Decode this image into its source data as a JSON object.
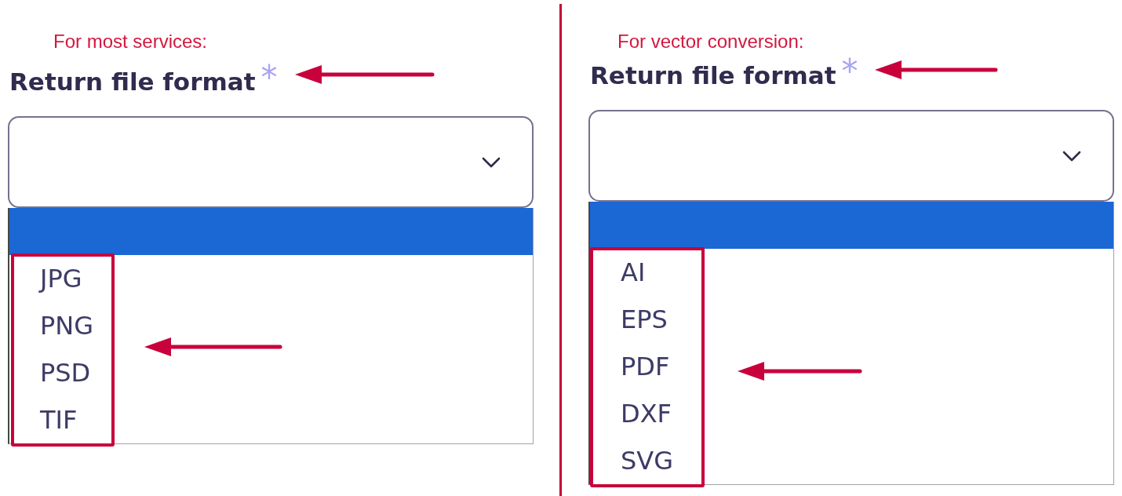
{
  "panels": [
    {
      "note": "For most services:",
      "field": {
        "label": "Return file format",
        "required_mark": "*",
        "expanded": true,
        "options": [
          {
            "selected": true
          },
          {
            "label": "JPG",
            "selected": false
          },
          {
            "label": "PNG",
            "selected": false
          },
          {
            "label": "PSD",
            "selected": false
          },
          {
            "label": "TIF",
            "selected": false
          }
        ]
      }
    },
    {
      "note": "For vector conversion:",
      "field": {
        "label": "Return file format",
        "required_mark": "*",
        "expanded": true,
        "options": [
          {
            "selected": true
          },
          {
            "label": "AI",
            "selected": false
          },
          {
            "label": "EPS",
            "selected": false
          },
          {
            "label": "PDF",
            "selected": false
          },
          {
            "label": "DXF",
            "selected": false
          },
          {
            "label": "SVG",
            "selected": false
          }
        ]
      }
    }
  ]
}
